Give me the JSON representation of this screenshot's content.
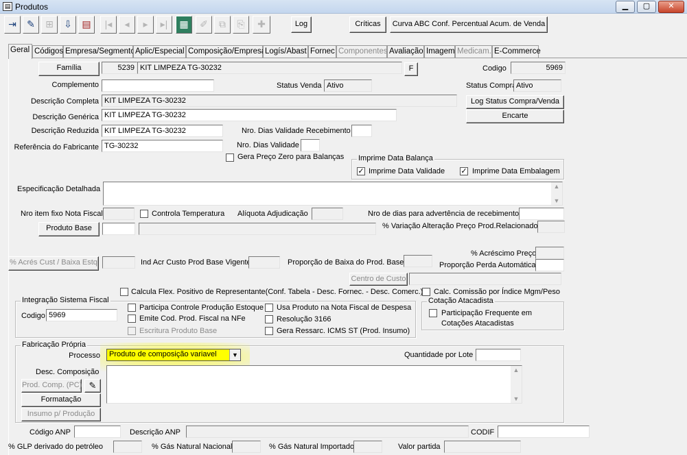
{
  "window": {
    "title": "Produtos",
    "min": "▁",
    "max": "▢",
    "close": "✕"
  },
  "toolbar": {
    "log_label": "Log",
    "criticas_label": "Críticas",
    "curva_label": "Curva ABC Conf. Percentual Acum. de Venda",
    "icons": [
      "exit-icon",
      "edit-icon",
      "tree-icon",
      "save-icon",
      "print-icon",
      "first-icon",
      "prev-icon",
      "next-icon",
      "last-icon",
      "grid-icon",
      "pencil-icon",
      "copy-icon",
      "paste-icon",
      "new-icon"
    ]
  },
  "tabs": [
    "Geral",
    "Códigos",
    "Empresa/Segmento",
    "Aplic/Especial",
    "Composição/Empresa",
    "Logís/Abast",
    "Fornec",
    "Componentes",
    "Avaliação",
    "Imagem",
    "Medicam.",
    "E-Commerce"
  ],
  "general": {
    "familia_btn": "Família",
    "familia_code": "5239",
    "familia_name": "KIT LIMPEZA TG-30232",
    "f_btn": "F",
    "codigo_label": "Codigo",
    "codigo_value": "5969",
    "complemento_label": "Complemento",
    "status_venda_label": "Status Venda",
    "status_venda_value": "Ativo",
    "status_compra_label": "Status Compra",
    "status_compra_value": "Ativo",
    "desc_completa_label": "Descrição Completa",
    "desc_completa_value": "KIT LIMPEZA TG-30232",
    "log_status_btn": "Log Status Compra/Venda",
    "desc_generica_label": "Descrição Genérica",
    "desc_generica_value": "KIT LIMPEZA TG-30232",
    "encarte_btn": "Encarte",
    "desc_reduzida_label": "Descrição Reduzida",
    "desc_reduzida_value": "KIT LIMPEZA TG-30232",
    "dias_val_receb_label": "Nro. Dias Validade Recebimento",
    "ref_fabricante_label": "Referência do Fabricante",
    "ref_fabricante_value": "TG-30232",
    "dias_validade_label": "Nro. Dias Validade",
    "gera_preco_zero_label": "Gera Preço Zero para Balanças",
    "imprime_data_balanca_caption": "Imprime Data Balança",
    "imprime_data_validade_label": "Imprime Data Validade",
    "imprime_data_embalagem_label": "Imprime Data Embalagem",
    "check_mark": "✓",
    "especificacao_label": "Especificação Detalhada",
    "nro_item_fixo_label": "Nro item fixo Nota Fiscal",
    "controla_temp_label": "Controla Temperatura",
    "aliquota_label": "Alíquota Adjudicação",
    "nro_dias_advert_label": "Nro de dias para advertência de recebimento",
    "produto_base_btn": "Produto Base",
    "variacao_preco_label": "% Variação Alteração Preço Prod.Relacionado",
    "acrescimo_preco_label": "% Acréscimo Preço",
    "acres_cust_btn": "% Acrés Cust / Baixa Estq",
    "ind_acr_label": "Ind Acr Custo Prod Base Vigente",
    "proporcao_baixa_label": "Proporção de Baixa do Prod. Base",
    "proporcao_perda_label": "Proporção Perda Automática",
    "centro_custo_btn": "Centro de Custo",
    "calcula_flex_label": "Calcula Flex. Positivo de Representante(Conf. Tabela - Desc. Fornec. - Desc. Comerc.)",
    "calc_comissao_label": "Calc. Comissão por Índice Mgm/Peso"
  },
  "integracao": {
    "caption": "Integração Sistema Fiscal",
    "codigo_label": "Codigo",
    "codigo_value": "5969",
    "participa_label": "Participa Controle Produção Estoque",
    "emite_label": "Emite Cod. Prod. Fiscal na NFe",
    "escritura_label": "Escritura Produto Base",
    "usa_produto_label": "Usa Produto na Nota Fiscal de Despesa",
    "resolucao_label": "Resolução 3166",
    "gera_ressarc_label": "Gera Ressarc. ICMS ST (Prod. Insumo)"
  },
  "cotacao": {
    "caption": "Cotação Atacadista",
    "participacao_label_1": "Participação Frequente em",
    "participacao_label_2": "Cotações Atacadistas"
  },
  "fabricacao": {
    "caption": "Fabricação Própria",
    "processo_label": "Processo",
    "processo_value": "Produto de composição variavel",
    "quantidade_lote_label": "Quantidade por Lote",
    "desc_composicao_label": "Desc. Composição",
    "prod_comp_btn": "Prod. Comp. (PC)",
    "formatacao_btn": "Formatação",
    "insumo_btn": "Insumo p/ Produção"
  },
  "footer": {
    "codigo_anp_label": "Código ANP",
    "descricao_anp_label": "Descrição ANP",
    "codif_label": "CODIF",
    "glp_label": "% GLP derivado do petróleo",
    "gas_nacional_label": "% Gás Natural Nacional",
    "gas_importado_label": "% Gás Natural Importado",
    "valor_partida_label": "Valor partida"
  },
  "colors": {
    "highlight": "#ffff00",
    "window_bg": "#f0f0f0"
  }
}
